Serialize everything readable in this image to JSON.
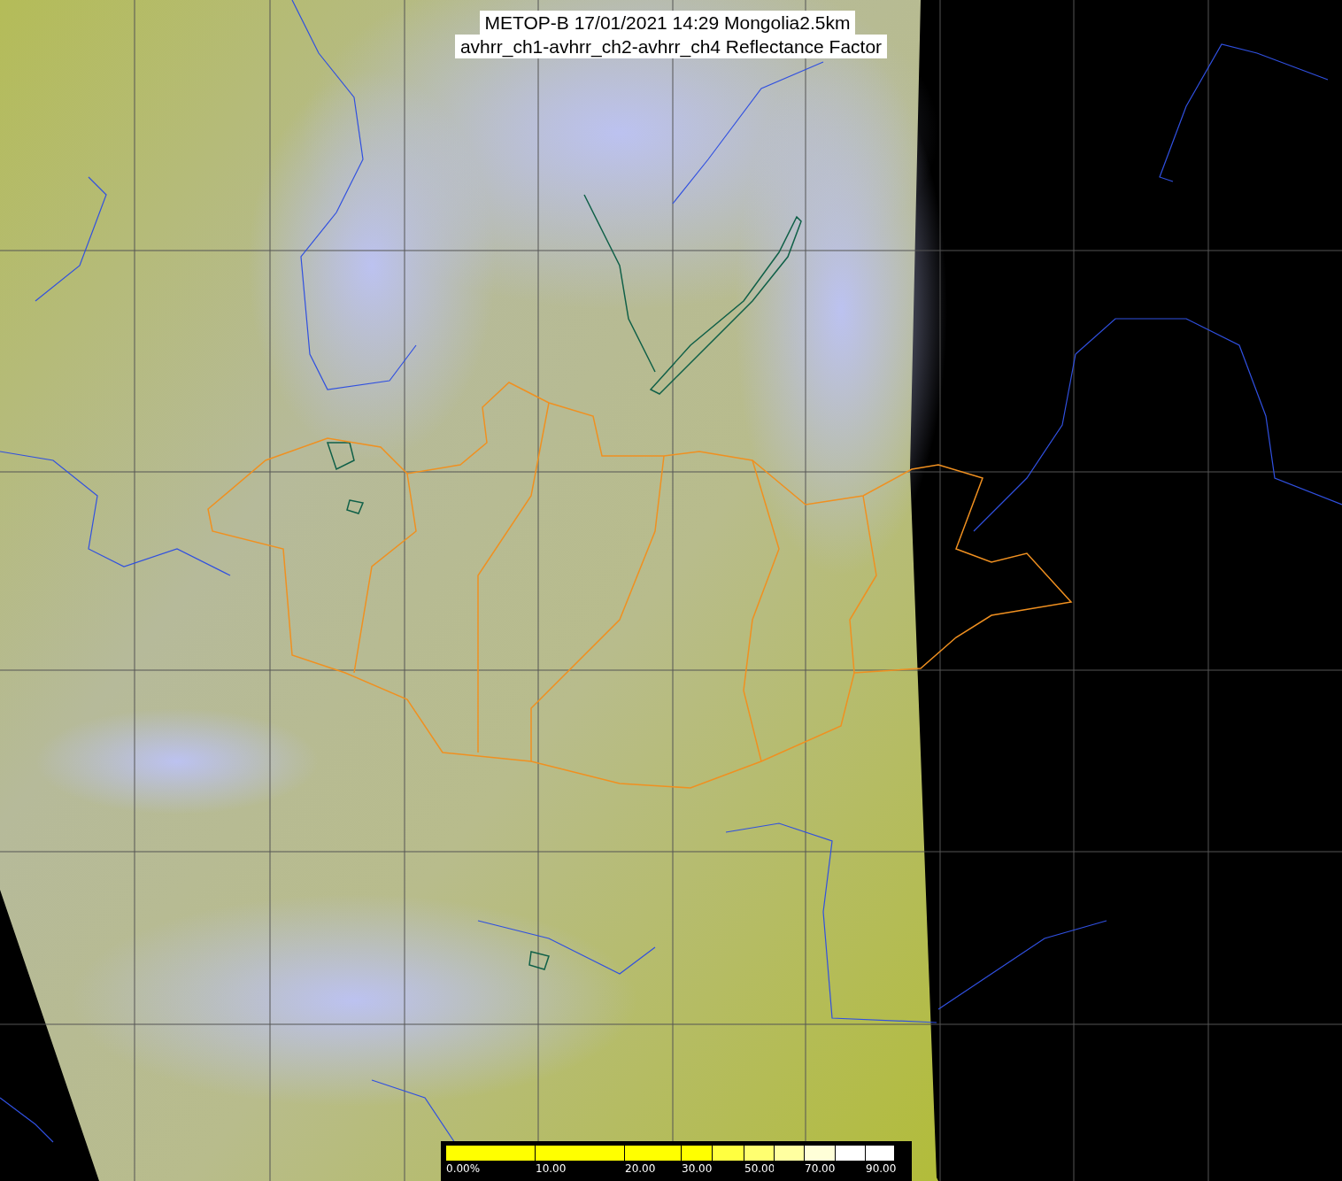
{
  "title": {
    "line_1": "METOP-B 17/01/2021 14:29 Mongolia2.5km",
    "line_2": "avhrr_ch1-avhrr_ch2-avhrr_ch4 Reflectance Factor"
  },
  "colorbar": {
    "segments": [
      {
        "color": "#ffff00",
        "label": "0.00%"
      },
      {
        "color": "#ffff00",
        "label": "10.00"
      },
      {
        "color": "#ffff00",
        "label": "20.00"
      },
      {
        "color": "#ffff00",
        "label": "30.00"
      },
      {
        "color": "#ffff40"
      },
      {
        "color": "#ffff70",
        "label": "50.00"
      },
      {
        "color": "#ffffa0"
      },
      {
        "color": "#ffffd8",
        "label": "70.00"
      },
      {
        "color": "#ffffff"
      },
      {
        "color": "#ffffff",
        "label": "90.00"
      }
    ]
  }
}
